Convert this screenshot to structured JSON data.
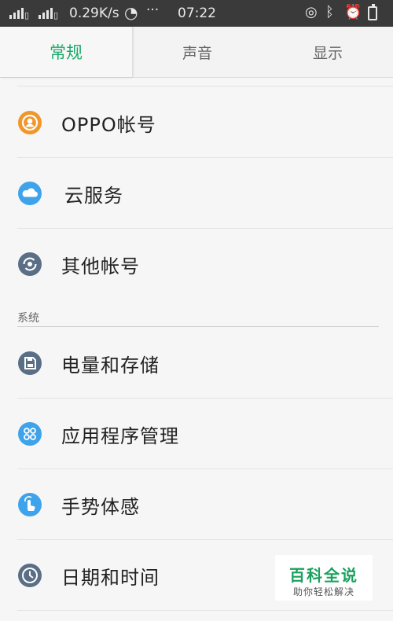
{
  "status_bar": {
    "network_speed": "0.29K/s",
    "more": "···",
    "time": "07:22"
  },
  "tabs": [
    {
      "label": "常规"
    },
    {
      "label": "声音"
    },
    {
      "label": "显示"
    }
  ],
  "accounts": [
    {
      "label": "OPPO帐号",
      "icon": "oppo-account-icon"
    },
    {
      "label": "云服务",
      "icon": "cloud-icon"
    },
    {
      "label": "其他帐号",
      "icon": "sync-account-icon"
    }
  ],
  "system_section": {
    "title": "系统",
    "items": [
      {
        "label": "电量和存储",
        "icon": "save-storage-icon"
      },
      {
        "label": "应用程序管理",
        "icon": "apps-icon"
      },
      {
        "label": "手势体感",
        "icon": "gesture-icon"
      },
      {
        "label": "日期和时间",
        "icon": "clock-icon"
      }
    ]
  },
  "watermark": {
    "title": "百科全说",
    "subtitle": "助你轻松解决"
  },
  "colors": {
    "accent": "#1ea96d",
    "orange": "#f1962a",
    "blue": "#3fa3ec",
    "slate": "#5a6e86"
  }
}
